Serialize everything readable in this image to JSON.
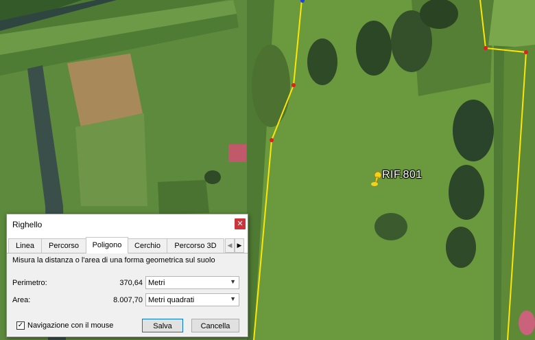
{
  "map": {
    "placemark_label": "RIF.801",
    "placemark_icon": "pushpin-icon",
    "polygon_color": "#ffe600",
    "vertex_color": "#e02020"
  },
  "ruler": {
    "title": "Righello",
    "close_icon": "close-icon",
    "tabs": [
      {
        "label": "Linea"
      },
      {
        "label": "Percorso"
      },
      {
        "label": "Poligono"
      },
      {
        "label": "Cerchio"
      },
      {
        "label": "Percorso 3D"
      }
    ],
    "active_tab": "Poligono",
    "description": "Misura la distanza o l'area di una forma geometrica sul suolo",
    "perimeter": {
      "label": "Perimetro:",
      "value": "370,64",
      "unit": "Metri"
    },
    "area": {
      "label": "Area:",
      "value": "8.007,70",
      "unit": "Metri quadrati"
    },
    "mouse_nav": {
      "label": "Navigazione con il mouse",
      "checked": true
    },
    "save_label": "Salva",
    "cancel_label": "Cancella"
  }
}
